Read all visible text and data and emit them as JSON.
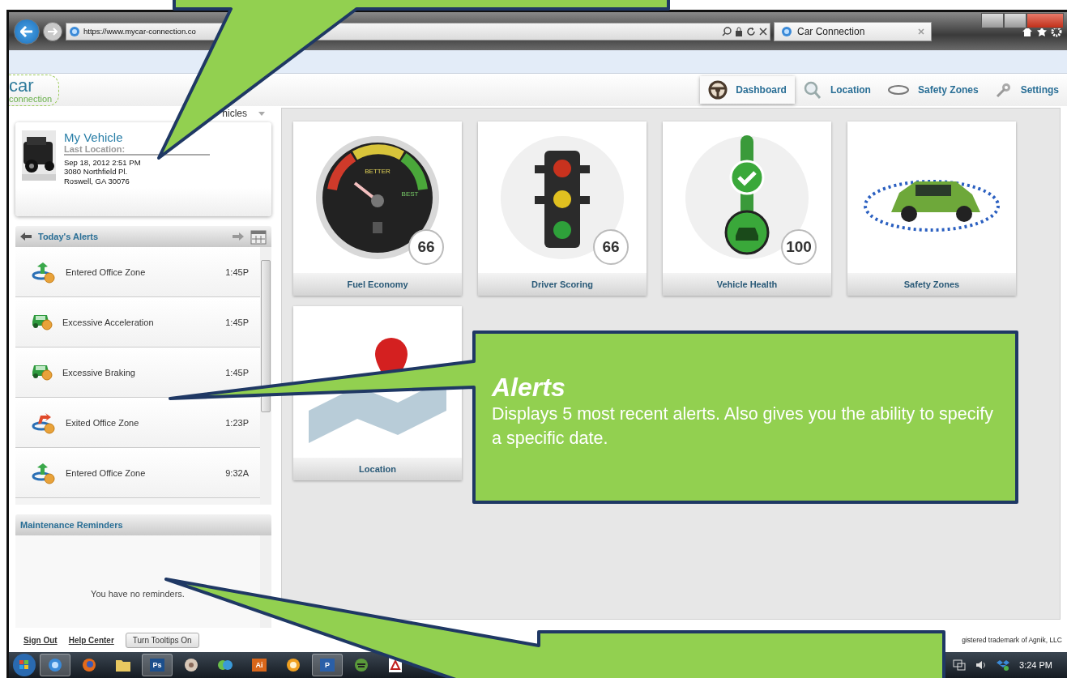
{
  "browser": {
    "url": "https://www.mycar-connection.co",
    "tab_title": "Car Connection"
  },
  "app": {
    "logo_top": "car",
    "logo_bottom": "connection",
    "nav": [
      {
        "label": "Dashboard",
        "kind": "wheel",
        "selected": true
      },
      {
        "label": "Location",
        "kind": "search",
        "selected": false
      },
      {
        "label": "Safety Zones",
        "kind": "ring",
        "selected": false
      },
      {
        "label": "Settings",
        "kind": "gear",
        "selected": false
      }
    ]
  },
  "vehicle_selector": "hicles",
  "vehicle": {
    "name": "My Vehicle",
    "last_location_label": "Last Location:",
    "lines": [
      "Sep 18, 2012 2:51 PM",
      "3080 Northfield Pl.",
      "Roswell, GA 30076"
    ]
  },
  "alerts": {
    "title": "Today's Alerts",
    "items": [
      {
        "kind": "entered",
        "label": "Entered Office Zone",
        "time": "1:45P"
      },
      {
        "kind": "car",
        "label": "Excessive Acceleration",
        "time": "1:45P"
      },
      {
        "kind": "car",
        "label": "Excessive Braking",
        "time": "1:45P"
      },
      {
        "kind": "exited",
        "label": "Exited Office Zone",
        "time": "1:23P"
      },
      {
        "kind": "entered",
        "label": "Entered Office Zone",
        "time": "9:32A"
      }
    ]
  },
  "reminders": {
    "title": "Maintenance Reminders",
    "message": "You have no reminders."
  },
  "tiles": [
    {
      "kind": "fuel",
      "label": "Fuel Economy",
      "score": "66",
      "gauge_labels": [
        "BETTER",
        "BEST"
      ]
    },
    {
      "kind": "driver",
      "label": "Driver Scoring",
      "score": "66"
    },
    {
      "kind": "health",
      "label": "Vehicle Health",
      "score": "100"
    },
    {
      "kind": "zones",
      "label": "Safety Zones"
    },
    {
      "kind": "location",
      "label": "Location"
    }
  ],
  "footer": {
    "links": [
      "Sign Out",
      "Help Center"
    ],
    "button": "Turn Tooltips On",
    "trademark": "gistered trademark of Agnik, LLC"
  },
  "taskbar": {
    "apps": [
      {
        "kind": "ie",
        "running": true
      },
      {
        "kind": "firefox",
        "running": false
      },
      {
        "kind": "folder",
        "running": false
      },
      {
        "kind": "tile",
        "label": "Ps",
        "color": "#1c4f8c",
        "running": true
      },
      {
        "kind": "disc",
        "running": false
      },
      {
        "kind": "arrows",
        "running": false
      },
      {
        "kind": "tile",
        "label": "Ai",
        "color": "#d9661a",
        "running": false
      },
      {
        "kind": "orange",
        "running": false
      },
      {
        "kind": "tile",
        "label": "P",
        "color": "#2a5fa8",
        "running": true
      },
      {
        "kind": "green",
        "running": false
      },
      {
        "kind": "pdf"
      }
    ],
    "clock": "3:24 PM"
  },
  "callouts": [
    {
      "kind": "top"
    },
    {
      "kind": "middle",
      "title": "Alerts",
      "text": "Displays 5 most recent alerts.  Also gives you the ability to specify a specific date."
    },
    {
      "kind": "bottom"
    }
  ]
}
